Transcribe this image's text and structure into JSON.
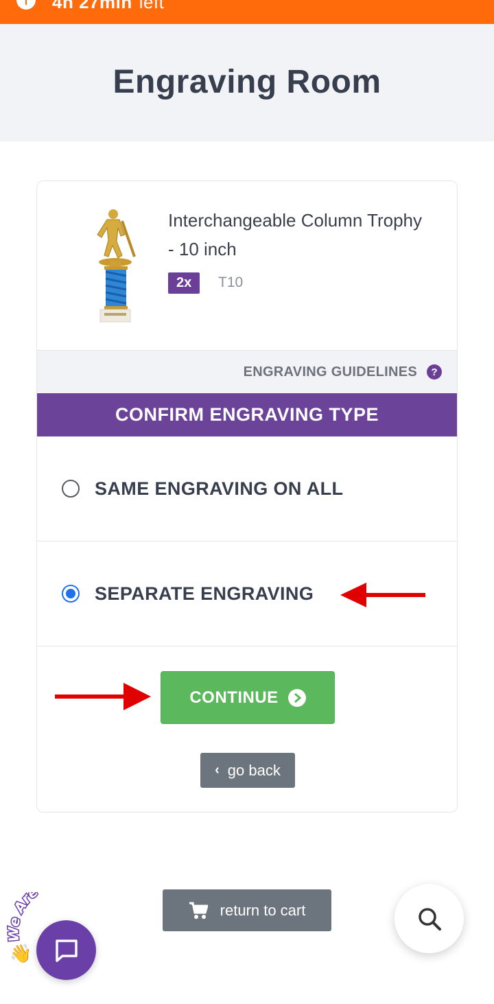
{
  "top_bar": {
    "time_value": "4h 27min",
    "time_suffix": "left",
    "color": "#ff6a0a"
  },
  "header": {
    "title": "Engraving Room"
  },
  "product": {
    "name": "Interchangeable Column Trophy - 10 inch",
    "quantity_badge": "2x",
    "sku": "T10"
  },
  "guidelines": {
    "label": "ENGRAVING GUIDELINES",
    "help_icon": "question-circle-icon"
  },
  "confirm": {
    "heading": "CONFIRM ENGRAVING TYPE",
    "options": [
      {
        "label": "SAME ENGRAVING ON ALL",
        "selected": false
      },
      {
        "label": "SEPARATE ENGRAVING",
        "selected": true
      }
    ]
  },
  "buttons": {
    "continue": "CONTINUE",
    "go_back": "go back",
    "return_to_cart": "return to cart"
  },
  "chat": {
    "badge_text": "We Are Here!",
    "wave_icon": "👋"
  },
  "colors": {
    "purple": "#6b4499",
    "green": "#5cb85c",
    "gray_button": "#6c757d",
    "radio_blue": "#1e73e8",
    "annotation_arrow": "#e00000"
  }
}
